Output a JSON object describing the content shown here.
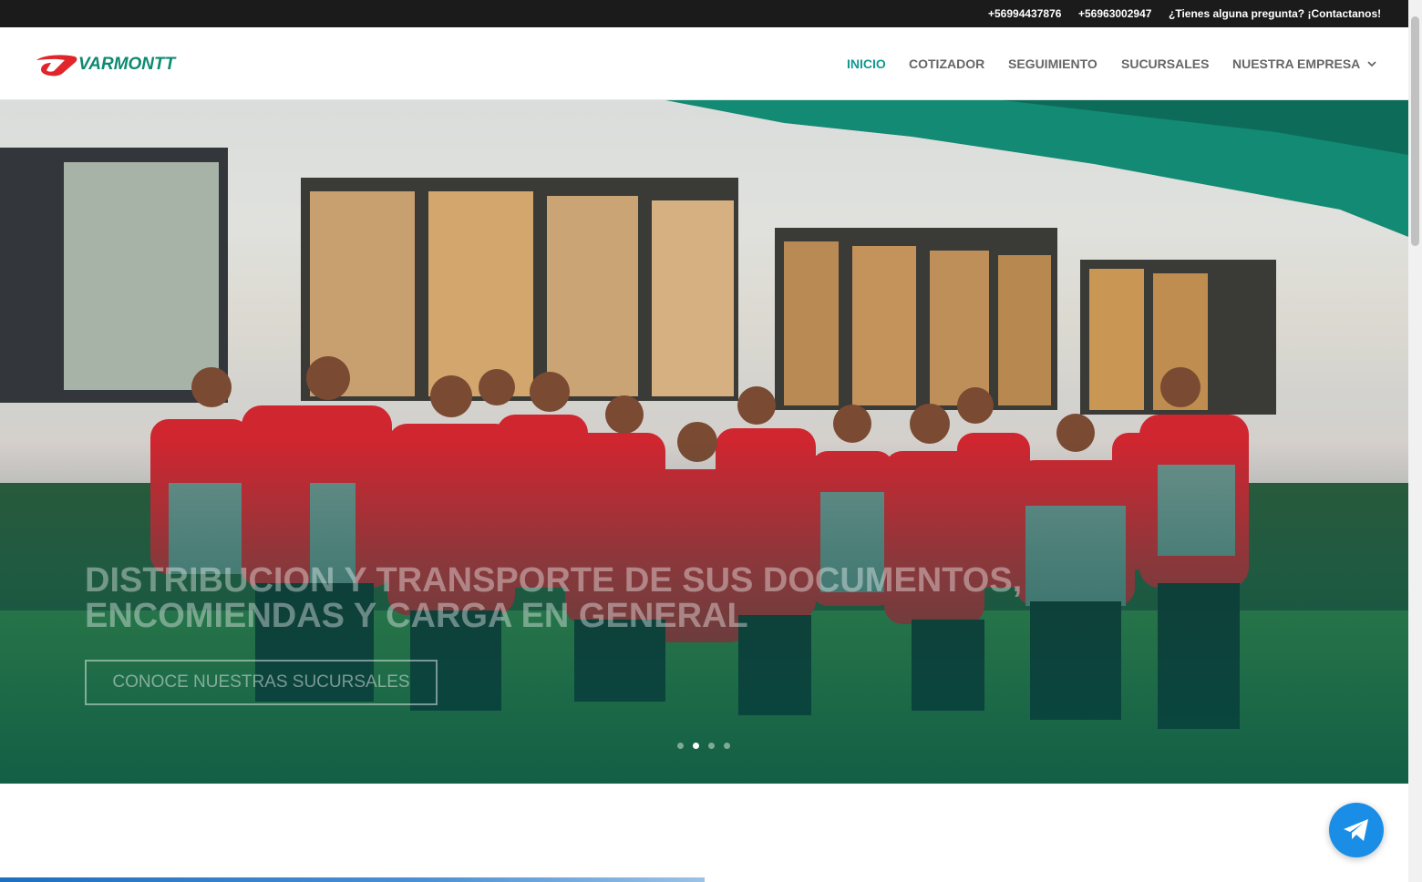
{
  "topbar": {
    "phone1": "+56994437876",
    "phone2": "+56963002947",
    "contact": "¿Tienes alguna pregunta? ¡Contactanos!"
  },
  "brand": {
    "name": "VARMONTT",
    "colors": {
      "red": "#e0262b",
      "green": "#0e8a72"
    }
  },
  "nav": {
    "items": [
      {
        "label": "INICIO",
        "active": true
      },
      {
        "label": "COTIZADOR",
        "active": false
      },
      {
        "label": "SEGUIMIENTO",
        "active": false
      },
      {
        "label": "SUCURSALES",
        "active": false
      },
      {
        "label": "NUESTRA EMPRESA",
        "active": false,
        "has_dropdown": true
      }
    ]
  },
  "hero": {
    "title": "DISTRIBUCION Y TRANSPORTE DE SUS DOCUMENTOS, ENCOMIENDAS Y CARGA EN GENERAL",
    "button_label": "CONOCE NUESTRAS SUCURSALES",
    "slide_count": 4,
    "active_slide": 2
  },
  "floating": {
    "icon": "telegram-icon",
    "color": "#1a8ee6"
  },
  "colors": {
    "accent": "#119a90",
    "topbar_bg": "#1b1b1b",
    "nav_text": "#666666"
  }
}
